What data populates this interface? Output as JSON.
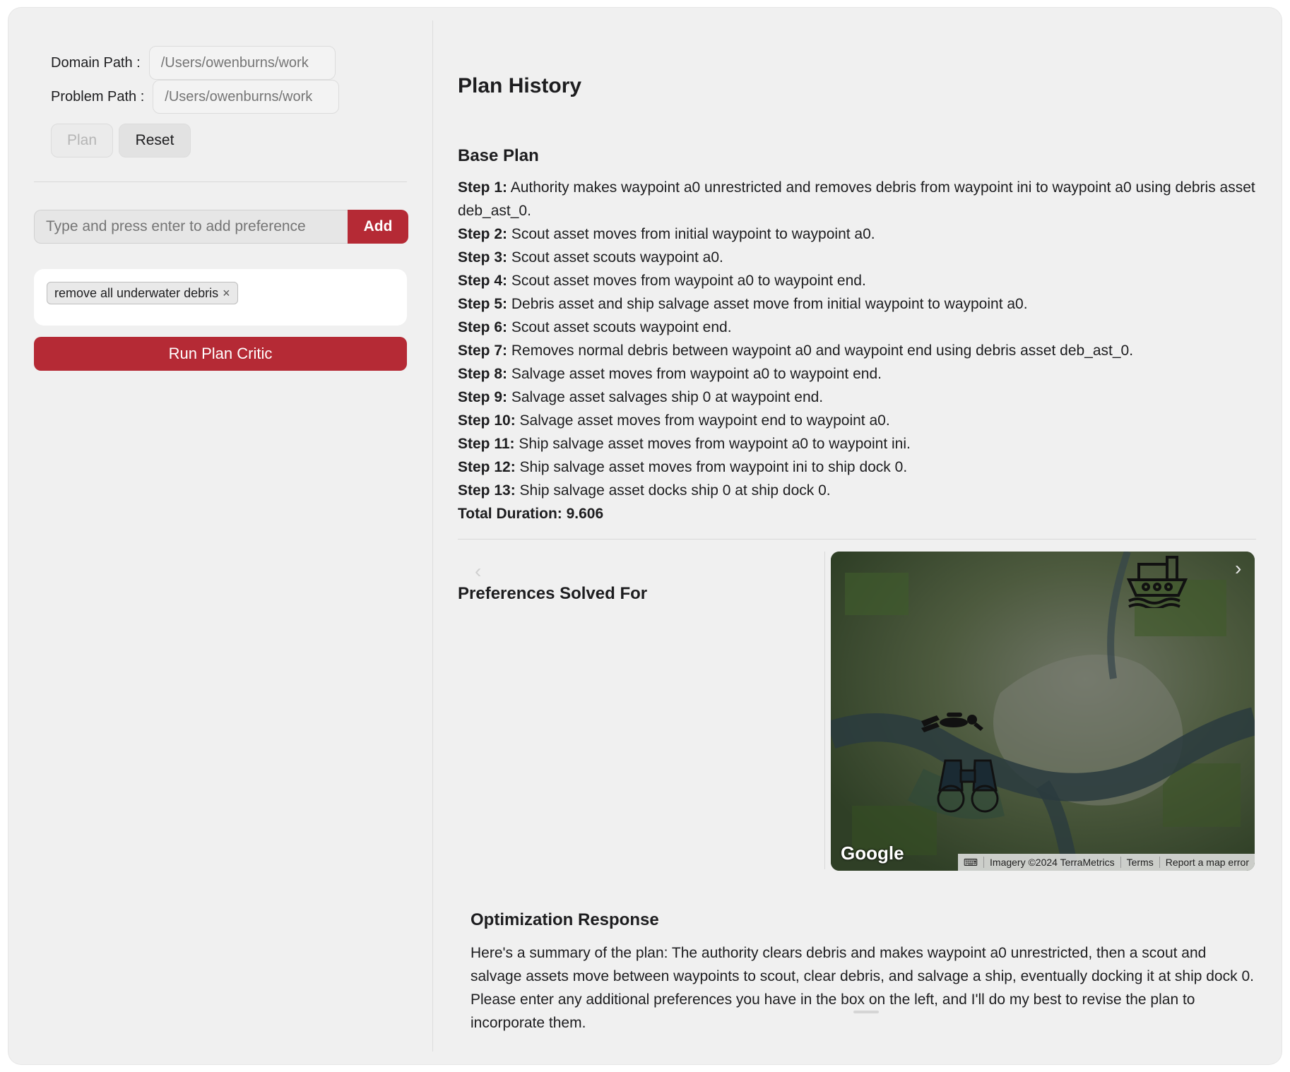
{
  "left": {
    "domain_label": "Domain Path",
    "domain_placeholder": "/Users/owenburns/work",
    "problem_label": "Problem Path",
    "problem_placeholder": "/Users/owenburns/work",
    "plan_button": "Plan",
    "reset_button": "Reset",
    "preference_placeholder": "Type and press enter to add preference",
    "add_button": "Add",
    "preferences": [
      "remove all underwater debris"
    ],
    "run_button": "Run Plan Critic"
  },
  "right": {
    "title": "Plan History",
    "base_plan_title": "Base Plan",
    "steps": [
      {
        "label": "Step 1:",
        "text": "Authority makes waypoint a0 unrestricted and removes debris from waypoint ini to waypoint a0 using debris asset deb_ast_0."
      },
      {
        "label": "Step 2:",
        "text": "Scout asset moves from initial waypoint to waypoint a0."
      },
      {
        "label": "Step 3:",
        "text": "Scout asset scouts waypoint a0."
      },
      {
        "label": "Step 4:",
        "text": "Scout asset moves from waypoint a0 to waypoint end."
      },
      {
        "label": "Step 5:",
        "text": "Debris asset and ship salvage asset move from initial waypoint to waypoint a0."
      },
      {
        "label": "Step 6:",
        "text": "Scout asset scouts waypoint end."
      },
      {
        "label": "Step 7:",
        "text": "Removes normal debris between waypoint a0 and waypoint end using debris asset deb_ast_0."
      },
      {
        "label": "Step 8:",
        "text": "Salvage asset moves from waypoint a0 to waypoint end."
      },
      {
        "label": "Step 9:",
        "text": "Salvage asset salvages ship 0 at waypoint end."
      },
      {
        "label": "Step 10:",
        "text": "Salvage asset moves from waypoint end to waypoint a0."
      },
      {
        "label": "Step 11:",
        "text": "Ship salvage asset moves from waypoint a0 to waypoint ini."
      },
      {
        "label": "Step 12:",
        "text": "Ship salvage asset moves from waypoint ini to ship dock 0."
      },
      {
        "label": "Step 13:",
        "text": "Ship salvage asset docks ship 0 at ship dock 0."
      }
    ],
    "total_duration": "Total Duration: 9.606",
    "preferences_title": "Preferences Solved For",
    "map": {
      "logo": "Google",
      "attribution": [
        "Imagery ©2024 TerraMetrics",
        "Terms",
        "Report a map error"
      ],
      "icons": [
        "ship-icon",
        "diver-icon",
        "binoculars-icon"
      ]
    },
    "optimization_title": "Optimization Response",
    "optimization_text": "Here's a summary of the plan: The authority clears debris and makes waypoint a0 unrestricted, then a scout and salvage assets move between waypoints to scout, clear debris, and salvage a ship, eventually docking it at ship dock 0. Please enter any additional preferences you have in the box on the left, and I'll do my best to revise the plan to incorporate them."
  },
  "colors": {
    "accent": "#b52a35",
    "panel_bg": "#f0f0f0"
  }
}
